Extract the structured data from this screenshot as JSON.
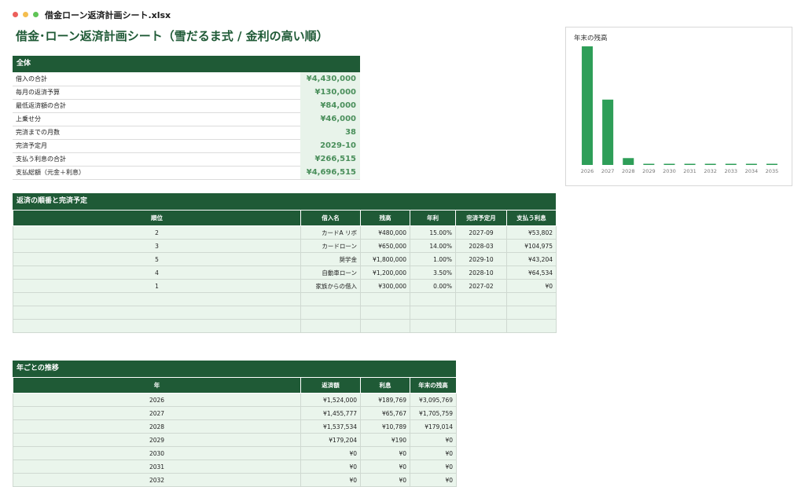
{
  "window": {
    "filename": "借金ローン返済計画シート.xlsx"
  },
  "sheet_title": "借金･ローン返済計画シート（雪だるま式 / 金利の高い順）",
  "summary": {
    "header": "全体",
    "rows": [
      {
        "label": "借入の合計",
        "value": "¥4,430,000"
      },
      {
        "label": "毎月の返済予算",
        "value": "¥130,000"
      },
      {
        "label": "最低返済額の合計",
        "value": "¥84,000"
      },
      {
        "label": "上乗せ分",
        "value": "¥46,000"
      },
      {
        "label": "完済までの月数",
        "value": "38"
      },
      {
        "label": "完済予定月",
        "value": "2029-10"
      },
      {
        "label": "支払う利息の合計",
        "value": "¥266,515"
      },
      {
        "label": "支払総額（元金＋利息）",
        "value": "¥4,696,515"
      }
    ]
  },
  "order_table": {
    "header": "返済の順番と完済予定",
    "columns": [
      "順位",
      "借入名",
      "残高",
      "年利",
      "完済予定月",
      "支払う利息"
    ],
    "rows": [
      [
        "2",
        "カードA リボ",
        "¥480,000",
        "15.00%",
        "2027-09",
        "¥53,802"
      ],
      [
        "3",
        "カードローン",
        "¥650,000",
        "14.00%",
        "2028-03",
        "¥104,975"
      ],
      [
        "5",
        "奨学金",
        "¥1,800,000",
        "1.00%",
        "2029-10",
        "¥43,204"
      ],
      [
        "4",
        "自動車ローン",
        "¥1,200,000",
        "3.50%",
        "2028-10",
        "¥64,534"
      ],
      [
        "1",
        "家族からの借入",
        "¥300,000",
        "0.00%",
        "2027-02",
        "¥0"
      ],
      [
        "",
        "",
        "",
        "",
        "",
        ""
      ],
      [
        "",
        "",
        "",
        "",
        "",
        ""
      ],
      [
        "",
        "",
        "",
        "",
        "",
        ""
      ]
    ]
  },
  "yearly_table": {
    "header": "年ごとの推移",
    "columns": [
      "年",
      "返済額",
      "利息",
      "年末の残高"
    ],
    "rows": [
      [
        "2026",
        "¥1,524,000",
        "¥189,769",
        "¥3,095,769"
      ],
      [
        "2027",
        "¥1,455,777",
        "¥65,767",
        "¥1,705,759"
      ],
      [
        "2028",
        "¥1,537,534",
        "¥10,789",
        "¥179,014"
      ],
      [
        "2029",
        "¥179,204",
        "¥190",
        "¥0"
      ],
      [
        "2030",
        "¥0",
        "¥0",
        "¥0"
      ],
      [
        "2031",
        "¥0",
        "¥0",
        "¥0"
      ],
      [
        "2032",
        "¥0",
        "¥0",
        "¥0"
      ]
    ]
  },
  "chart_data": {
    "type": "bar",
    "title": "年末の残高",
    "categories": [
      "2026",
      "2027",
      "2028",
      "2029",
      "2030",
      "2031",
      "2032",
      "2033",
      "2034",
      "2035"
    ],
    "values": [
      3095769,
      1705759,
      179014,
      0,
      0,
      0,
      0,
      0,
      0,
      0
    ],
    "color": "#2e9e58"
  }
}
